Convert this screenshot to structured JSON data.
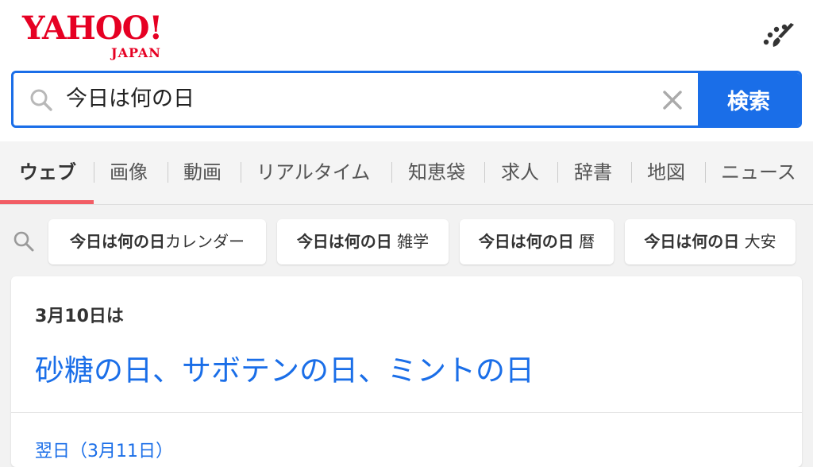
{
  "header": {
    "logo_main": "YAHOO!",
    "logo_sub": "JAPAN",
    "theme_icon": "brush-palette-icon"
  },
  "search": {
    "query": "今日は何の日",
    "button_label": "検索",
    "search_icon": "search-icon",
    "clear_icon": "close-icon"
  },
  "tabs": [
    {
      "label": "ウェブ",
      "active": true
    },
    {
      "label": "画像"
    },
    {
      "label": "動画"
    },
    {
      "label": "リアルタイム"
    },
    {
      "label": "知恵袋"
    },
    {
      "label": "求人"
    },
    {
      "label": "辞書"
    },
    {
      "label": "地図"
    },
    {
      "label": "ニュース"
    }
  ],
  "suggestions": [
    {
      "bold": "今日は何の日",
      "rest": "カレンダー"
    },
    {
      "bold": "今日は何の日",
      "rest": " 雑学"
    },
    {
      "bold": "今日は何の日",
      "rest": " 暦"
    },
    {
      "bold": "今日は何の日",
      "rest": " 大安"
    }
  ],
  "result": {
    "date_label": "3月10日は",
    "day_names": "砂糖の日、サボテンの日、ミントの日",
    "next_day": "翌日（3月11日）"
  },
  "colors": {
    "brand_red": "#e60023",
    "accent_blue": "#1a6ee8",
    "tab_underline": "#f25d65"
  }
}
